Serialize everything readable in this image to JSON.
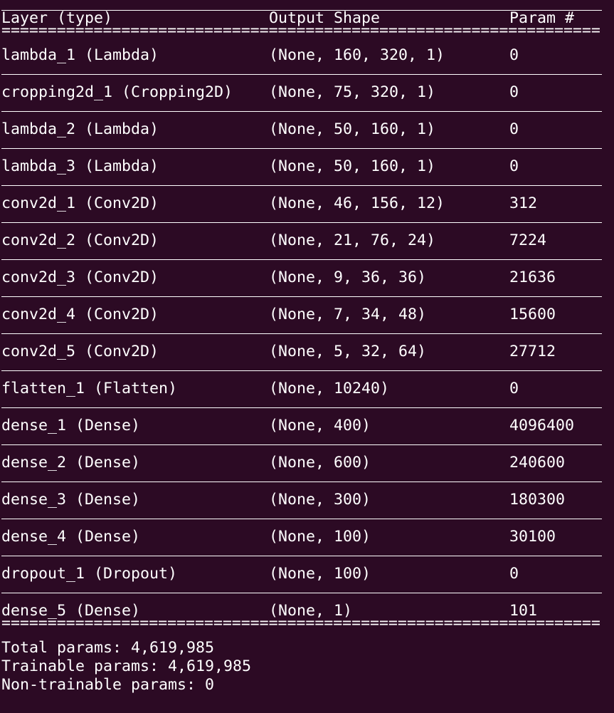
{
  "header": {
    "layer": "Layer (type)",
    "output_shape": "Output Shape",
    "param": "Param #"
  },
  "separator_double": "=================================================================",
  "layers": [
    {
      "layer": "lambda_1 (Lambda)",
      "shape": "(None, 160, 320, 1)",
      "params": "0"
    },
    {
      "layer": "cropping2d_1 (Cropping2D)",
      "shape": "(None, 75, 320, 1)",
      "params": "0"
    },
    {
      "layer": "lambda_2 (Lambda)",
      "shape": "(None, 50, 160, 1)",
      "params": "0"
    },
    {
      "layer": "lambda_3 (Lambda)",
      "shape": "(None, 50, 160, 1)",
      "params": "0"
    },
    {
      "layer": "conv2d_1 (Conv2D)",
      "shape": "(None, 46, 156, 12)",
      "params": "312"
    },
    {
      "layer": "conv2d_2 (Conv2D)",
      "shape": "(None, 21, 76, 24)",
      "params": "7224"
    },
    {
      "layer": "conv2d_3 (Conv2D)",
      "shape": "(None, 9, 36, 36)",
      "params": "21636"
    },
    {
      "layer": "conv2d_4 (Conv2D)",
      "shape": "(None, 7, 34, 48)",
      "params": "15600"
    },
    {
      "layer": "conv2d_5 (Conv2D)",
      "shape": "(None, 5, 32, 64)",
      "params": "27712"
    },
    {
      "layer": "flatten_1 (Flatten)",
      "shape": "(None, 10240)",
      "params": "0"
    },
    {
      "layer": "dense_1 (Dense)",
      "shape": "(None, 400)",
      "params": "4096400"
    },
    {
      "layer": "dense_2 (Dense)",
      "shape": "(None, 600)",
      "params": "240600"
    },
    {
      "layer": "dense_3 (Dense)",
      "shape": "(None, 300)",
      "params": "180300"
    },
    {
      "layer": "dense_4 (Dense)",
      "shape": "(None, 100)",
      "params": "30100"
    },
    {
      "layer": "dropout_1 (Dropout)",
      "shape": "(None, 100)",
      "params": "0"
    },
    {
      "layer": "dense_5 (Dense)",
      "shape": "(None, 1)",
      "params": "101"
    }
  ],
  "summary": {
    "total": "Total params: 4,619,985",
    "trainable": "Trainable params: 4,619,985",
    "non_trainable": "Non-trainable params: 0"
  },
  "colors": {
    "background": "#2c0a24",
    "text": "#ffffff"
  }
}
